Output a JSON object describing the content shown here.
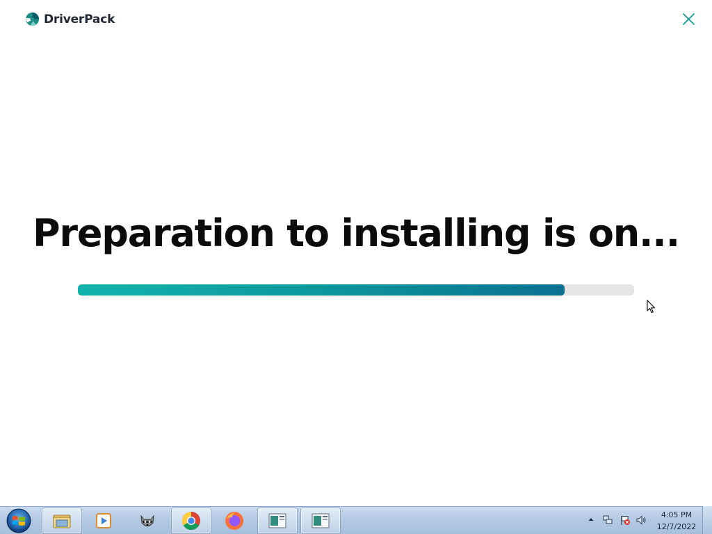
{
  "app": {
    "name": "DriverPack",
    "logo_icon": "driverpack-logo-icon",
    "close_icon": "close-icon"
  },
  "main": {
    "title": "Preparation to installing is on...",
    "progress_fraction": 0.875
  },
  "colors": {
    "accent_start": "#12b3ac",
    "accent_end": "#0a7191",
    "track": "#e6e6e6",
    "close": "#169c93"
  },
  "taskbar": {
    "start_icon": "windows-start-orb-icon",
    "apps": [
      {
        "icon": "windows-explorer-icon",
        "active": true
      },
      {
        "icon": "media-player-icon",
        "active": false
      },
      {
        "icon": "raccoon-app-icon",
        "active": false
      },
      {
        "icon": "chrome-icon",
        "active": true
      },
      {
        "icon": "firefox-icon",
        "active": false
      },
      {
        "icon": "window-app-icon",
        "active": true
      },
      {
        "icon": "window-app-icon",
        "active": true
      }
    ],
    "tray": {
      "icons": [
        "show-hidden-icons-arrow-icon",
        "network-icon",
        "action-center-flag-icon",
        "volume-icon"
      ],
      "time": "4:05 PM",
      "date": "12/7/2022"
    }
  }
}
